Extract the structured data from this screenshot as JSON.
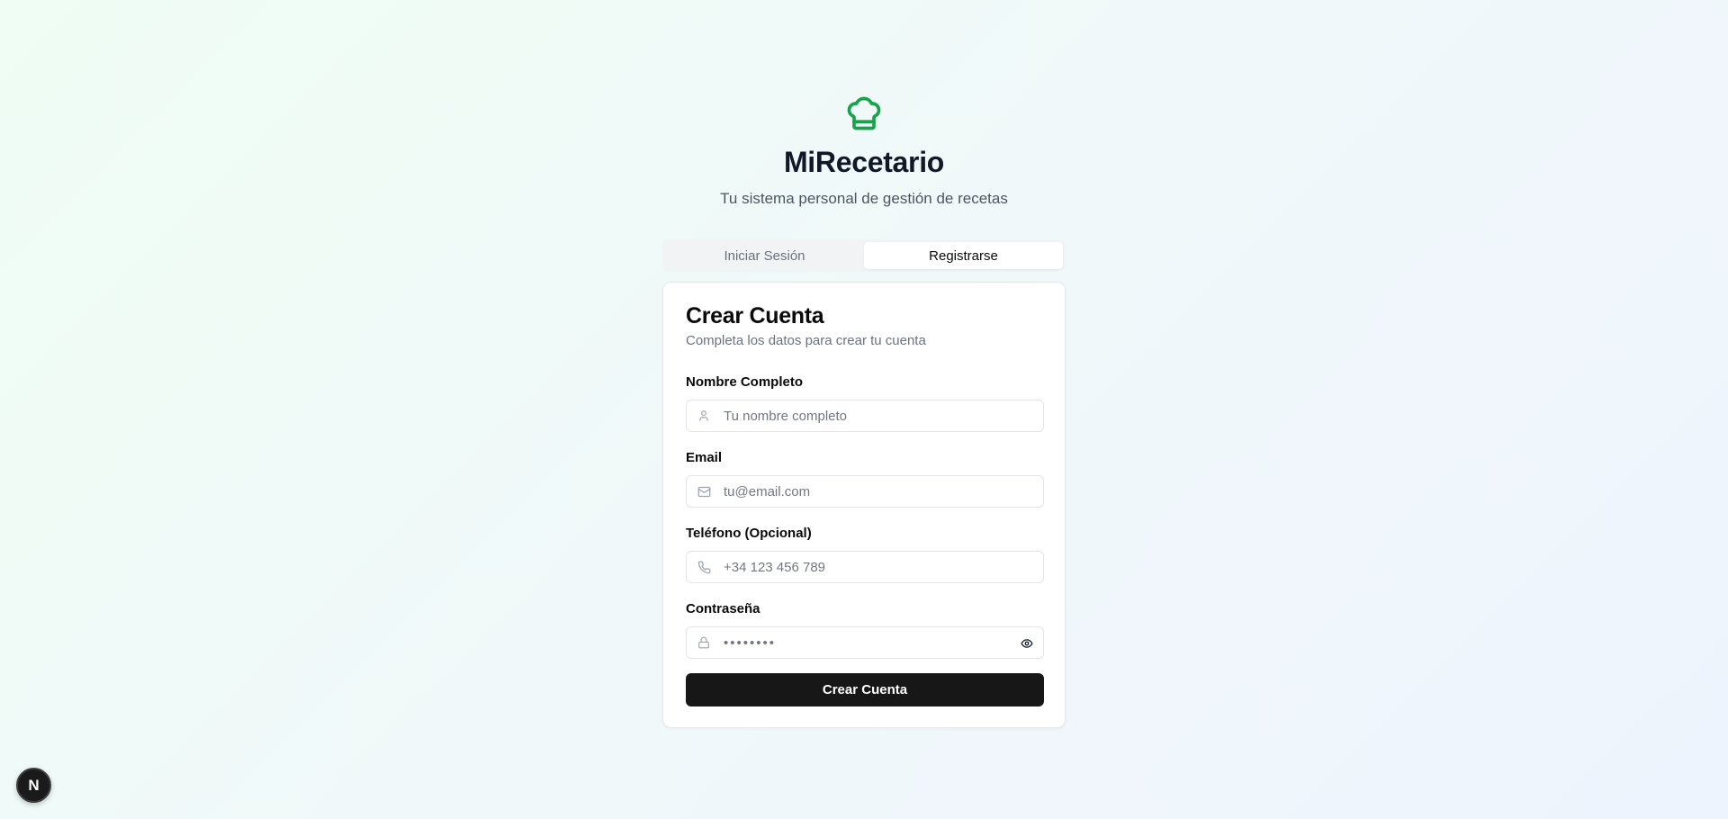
{
  "brand": {
    "title": "MiRecetario",
    "subtitle": "Tu sistema personal de gestión de recetas",
    "icon": "chef-hat-icon",
    "accent_color": "#16a34a"
  },
  "tabs": [
    {
      "label": "Iniciar Sesión",
      "active": false
    },
    {
      "label": "Registrarse",
      "active": true
    }
  ],
  "form": {
    "title": "Crear Cuenta",
    "description": "Completa los datos para crear tu cuenta",
    "fields": [
      {
        "label": "Nombre Completo",
        "placeholder": "Tu nombre completo",
        "value": "",
        "icon": "user-icon"
      },
      {
        "label": "Email",
        "placeholder": "tu@email.com",
        "value": "",
        "icon": "mail-icon"
      },
      {
        "label": "Teléfono (Opcional)",
        "placeholder": "+34 123 456 789",
        "value": "",
        "icon": "phone-icon"
      },
      {
        "label": "Contraseña",
        "placeholder": "••••••••",
        "value": "",
        "icon": "lock-icon"
      }
    ],
    "submit_label": "Crear Cuenta"
  },
  "dev_badge": {
    "label": "N"
  }
}
